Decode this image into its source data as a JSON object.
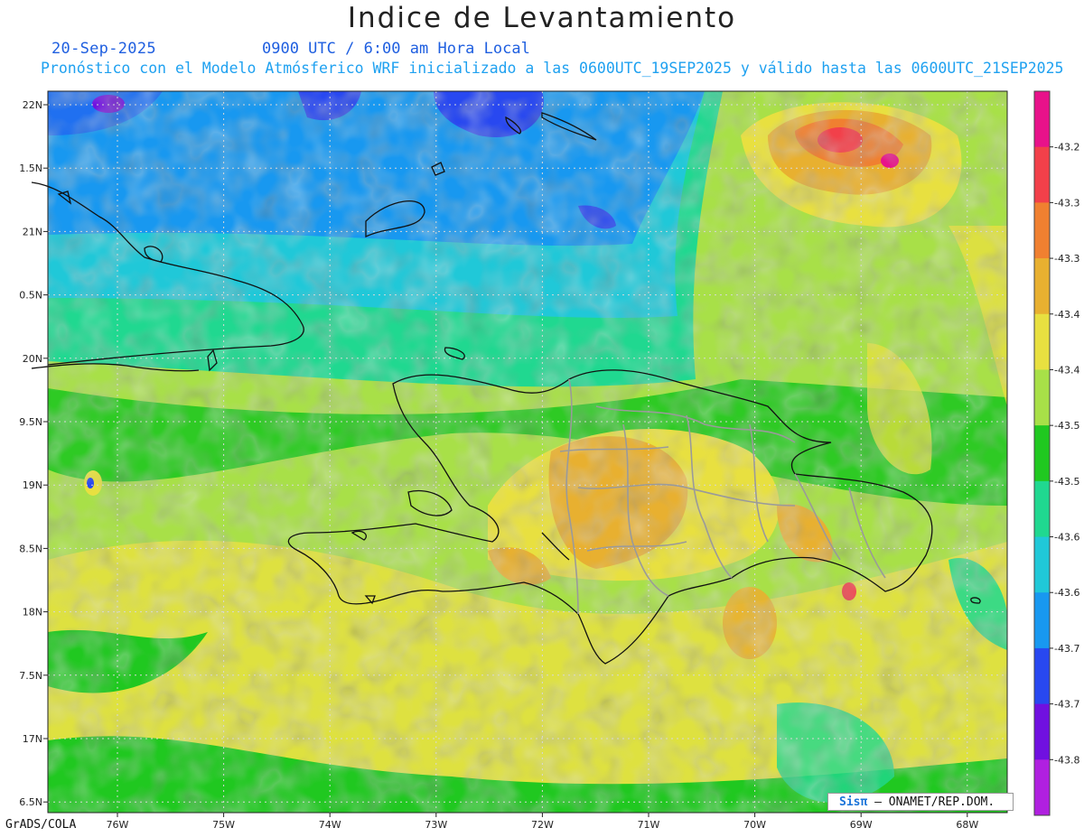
{
  "title": "Indice de Levantamiento",
  "date": "20-Sep-2025",
  "time_label": "0900 UTC / 6:00 am Hora Local",
  "forecast_line": "Pronóstico con el Modelo Atmósferico WRF inicializado a las 0600UTC_19SEP2025 y válido hasta las  0600UTC_21SEP2025",
  "footer_left": "GrADS/COLA",
  "credit": {
    "logo": "Sisπ",
    "text": "– ONAMET/REP.DOM."
  },
  "lat_labels": [
    "22N",
    "1.5N",
    "21N",
    "0.5N",
    "20N",
    "9.5N",
    "19N",
    "8.5N",
    "18N",
    "7.5N",
    "17N",
    "6.5N"
  ],
  "lon_labels": [
    "76W",
    "75W",
    "74W",
    "73W",
    "72W",
    "71W",
    "70W",
    "69W",
    "68W"
  ],
  "colorbar": {
    "labels": [
      "-43.2",
      "-43.3",
      "-43.3",
      "-43.4",
      "-43.4",
      "-43.5",
      "-43.5",
      "-43.6",
      "-43.6",
      "-43.7",
      "-43.7",
      "-43.8"
    ],
    "colors": [
      "#e8128a",
      "#f2404a",
      "#f08030",
      "#e8b030",
      "#e8e040",
      "#a8e048",
      "#20c820",
      "#20d890",
      "#20c8d8",
      "#1898f0",
      "#2848f0",
      "#7010e0",
      "#b020e0"
    ]
  }
}
